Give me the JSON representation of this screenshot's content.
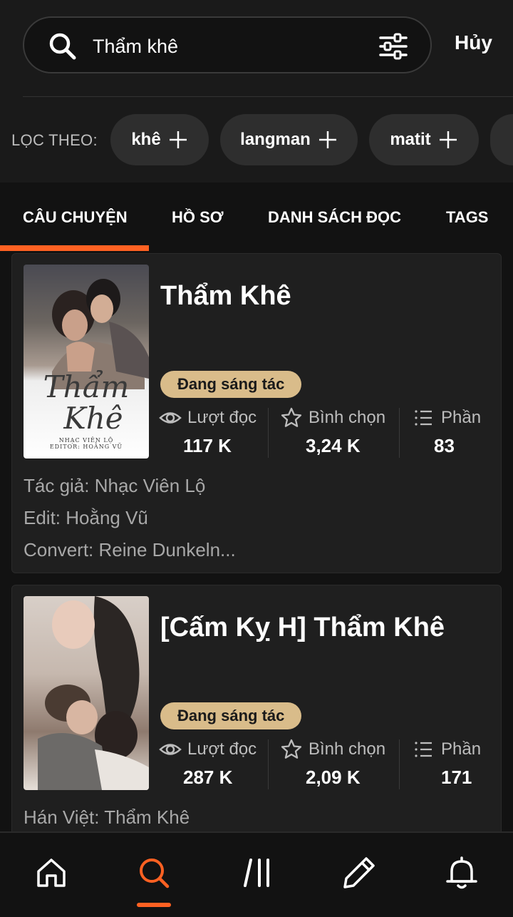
{
  "search": {
    "query": "Thẩm khê",
    "cancel_label": "Hủy"
  },
  "filter": {
    "label": "LỌC THEO:",
    "chips": [
      "khê",
      "langman",
      "matit"
    ]
  },
  "tabs": [
    "CÂU CHUYỆN",
    "HỒ SƠ",
    "DANH SÁCH ĐỌC",
    "TAGS"
  ],
  "stat_labels": {
    "reads": "Lượt đọc",
    "votes": "Bình chọn",
    "parts": "Phần"
  },
  "stories": [
    {
      "title": "Thẩm Khê",
      "status": "Đang sáng tác",
      "reads": "117 K",
      "votes": "3,24 K",
      "parts": "83",
      "cover_text": {
        "title_line1": "Thẩm",
        "title_line2": "Khê",
        "author": "NHẠC VIÊN LỘ",
        "editor": "EDITOR: HOẰNG VŨ"
      },
      "meta": [
        "Tác giả: Nhạc Viên Lộ",
        "Edit: Hoằng Vũ",
        "Convert: Reine Dunkeln..."
      ]
    },
    {
      "title": "[Cấm Kỵ H] Thẩm Khê",
      "status": "Đang sáng tác",
      "reads": "287 K",
      "votes": "2,09 K",
      "parts": "171",
      "meta": [
        "Hán Việt: Thẩm Khê"
      ]
    }
  ],
  "colors": {
    "accent": "#ff6122",
    "status_badge": "#d9bc8a",
    "background": "#121212",
    "card": "#1f1f1f"
  },
  "nav": [
    "home-icon",
    "search-icon",
    "library-icon",
    "write-icon",
    "bell-icon"
  ]
}
